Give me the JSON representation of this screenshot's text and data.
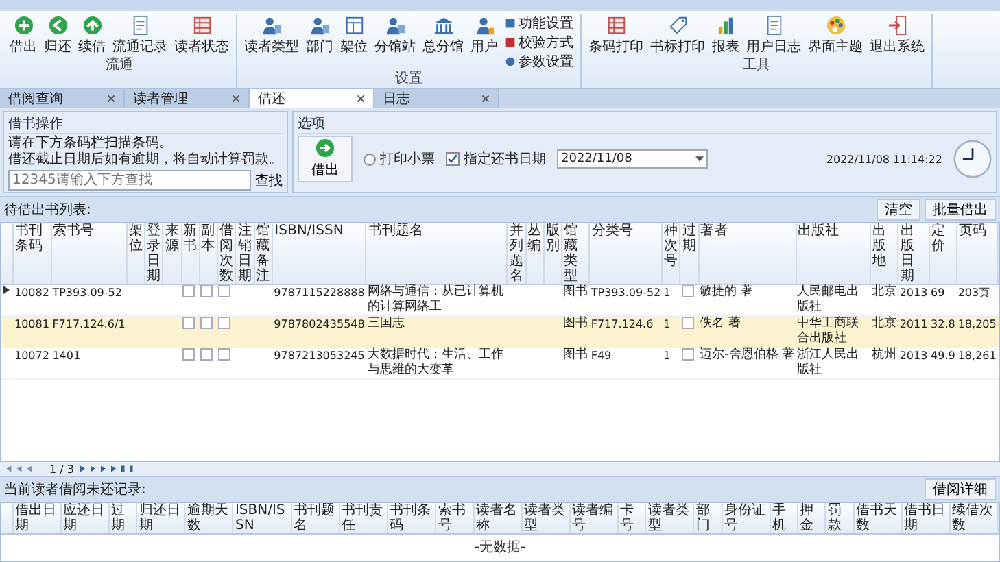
{
  "ribbon": {
    "groups": [
      {
        "label": "流通",
        "buttons": [
          {
            "label": "借出",
            "kind": "plus"
          },
          {
            "label": "归还",
            "kind": "back"
          },
          {
            "label": "续借",
            "kind": "up"
          },
          {
            "label": "流通记录",
            "kind": "doc"
          },
          {
            "label": "读者状态",
            "kind": "grid"
          }
        ]
      },
      {
        "label": "设置",
        "buttons": [
          {
            "label": "读者类型",
            "kind": "people"
          },
          {
            "label": "部门",
            "kind": "people"
          },
          {
            "label": "架位",
            "kind": "shelf"
          },
          {
            "label": "分馆站",
            "kind": "people"
          },
          {
            "label": "总分馆",
            "kind": "bank"
          },
          {
            "label": "用户",
            "kind": "user"
          }
        ],
        "small": [
          {
            "label": "功能设置",
            "kind": "grid"
          },
          {
            "label": "校验方式",
            "kind": "flag"
          },
          {
            "label": "参数设置",
            "kind": "gear"
          }
        ]
      },
      {
        "label": "工具",
        "buttons": [
          {
            "label": "条码打印",
            "kind": "grid"
          },
          {
            "label": "书标打印",
            "kind": "tag"
          },
          {
            "label": "报表",
            "kind": "chart"
          },
          {
            "label": "用户日志",
            "kind": "doc"
          },
          {
            "label": "界面主题",
            "kind": "palette"
          },
          {
            "label": "退出系统",
            "kind": "exit"
          }
        ]
      }
    ]
  },
  "doc_tabs": [
    {
      "label": "借阅查询",
      "selected": false
    },
    {
      "label": "读者管理",
      "selected": false
    },
    {
      "label": "借还",
      "selected": true
    },
    {
      "label": "日志",
      "selected": false
    }
  ],
  "operation": {
    "title": "借书操作",
    "lines": [
      "请在下方条码栏扫描条码。",
      "借还截止日期后如有逾期，将自动计算罚款。"
    ],
    "placeholder": "12345请输入下方查找",
    "search_button": "查找"
  },
  "options": {
    "title": "选项",
    "action_button": "借出",
    "print_receipt": {
      "label": "打印小票",
      "checked": false
    },
    "due_date": {
      "label": "指定还书日期",
      "checked": true,
      "value": "2022/11/08"
    },
    "datetime": "2022/11/08 11:14:22"
  },
  "pending": {
    "title": "待借出书列表:",
    "buttons": [
      "清空",
      "批量借出"
    ],
    "columns": [
      "书刊条码",
      "索书号",
      "架位",
      "登录日期",
      "来源",
      "新书",
      "副本",
      "借阅次数",
      "注销日期",
      "馆藏备注",
      "ISBN/ISSN",
      "书刊题名",
      "并列题名",
      "丛编",
      "版别",
      "馆藏类型",
      "分类号",
      "种次号",
      "过期",
      "著者",
      "出版社",
      "出版地",
      "出版日期",
      "定价",
      "页码"
    ],
    "rows": [
      {
        "selected": false,
        "current": true,
        "cells": [
          "10082",
          "TP393.09-52",
          "",
          "",
          "",
          "",
          "",
          "",
          "",
          "",
          "9787115228888",
          "网络与通信：从已计算机的计算网络工",
          "",
          "",
          "",
          "图书",
          "TP393.09-52",
          "1",
          "",
          "敏捷的 著",
          "人民邮电出版社",
          "北京",
          "2013",
          "69",
          "203页"
        ]
      },
      {
        "selected": true,
        "current": false,
        "cells": [
          "10081",
          "F717.124.6/1",
          "",
          "",
          "",
          "",
          "",
          "",
          "",
          "",
          "9787802435548",
          "三国志",
          "",
          "",
          "",
          "图书",
          "F717.124.6",
          "1",
          "",
          "佚名 著",
          "中华工商联合出版社",
          "北京",
          "2011",
          "32.8",
          "18,205"
        ]
      },
      {
        "selected": false,
        "current": false,
        "cells": [
          "10072",
          "1401",
          "",
          "",
          "",
          "",
          "",
          "",
          "",
          "",
          "9787213053245",
          "大数据时代：生活、工作与思维的大变革",
          "",
          "",
          "",
          "图书",
          "F49",
          "1",
          "",
          "迈尔-舍恩伯格 著",
          "浙江人民出版社",
          "杭州",
          "2013",
          "49.9",
          "18,261"
        ]
      }
    ]
  },
  "pager": {
    "text": "1 / 3"
  },
  "history": {
    "title": "当前读者借阅未还记录:",
    "button": "借阅详细",
    "columns": [
      "借出日期",
      "应还日期",
      "过期",
      "归还日期",
      "逾期天数",
      "ISBN/ISSN",
      "书刊题名",
      "书刊责任",
      "书刊条码",
      "索书号",
      "读者名称",
      "读者类型",
      "读者编号",
      "卡号",
      "读者类型",
      "部门",
      "身份证号",
      "手机",
      "押金",
      "罚款",
      "借书天数",
      "借书日期",
      "续借次数"
    ],
    "empty_text": "-无数据-"
  }
}
